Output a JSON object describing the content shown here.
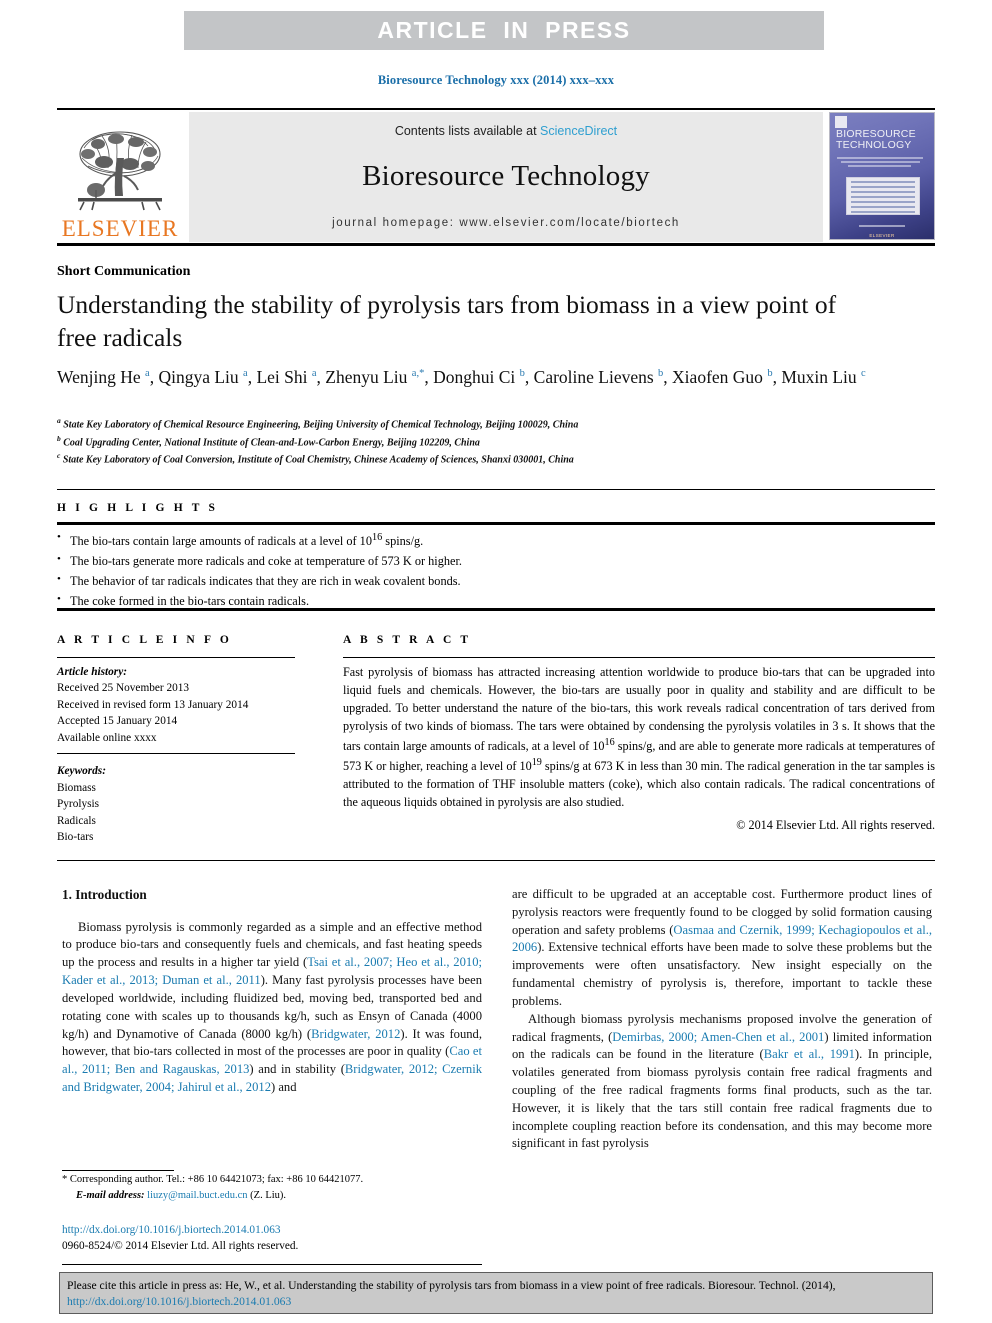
{
  "banner": {
    "text": "ARTICLE  IN  PRESS"
  },
  "running_head": "Bioresource Technology xxx (2014) xxx–xxx",
  "masthead": {
    "elsevier_wordmark": "ELSEVIER",
    "contents_prefix": "Contents lists available at ",
    "sciencedirect": "ScienceDirect",
    "journal_title": "Bioresource Technology",
    "homepage": "journal homepage: www.elsevier.com/locate/biortech",
    "cover_title_line1": "BIORESOURCE",
    "cover_title_line2": "TECHNOLOGY",
    "cover_publisher": "ELSEVIER"
  },
  "article": {
    "type": "Short Communication",
    "title": "Understanding the stability of pyrolysis tars from biomass in a view point of free radicals",
    "authors_html": "Wenjing He <sup>a</sup>, Qingya Liu <sup>a</sup>, Lei Shi <sup>a</sup>, Zhenyu Liu <sup>a,*</sup>, Donghui Ci <sup>b</sup>, Caroline Lievens <sup>b</sup>, Xiaofen Guo <sup>b</sup>, Muxin Liu <sup>c</sup>",
    "affiliations": [
      {
        "label": "a",
        "text": "State Key Laboratory of Chemical Resource Engineering, Beijing University of Chemical Technology, Beijing 100029, China"
      },
      {
        "label": "b",
        "text": "Coal Upgrading Center, National Institute of Clean-and-Low-Carbon Energy, Beijing 102209, China"
      },
      {
        "label": "c",
        "text": "State Key Laboratory of Coal Conversion, Institute of Coal Chemistry, Chinese Academy of Sciences, Shanxi 030001, China"
      }
    ]
  },
  "highlights": {
    "heading": "H I G H L I G H T S",
    "items_html": [
      "The bio-tars contain large amounts of radicals at a level of 10<sup>16</sup> spins/g.",
      "The bio-tars generate more radicals and coke at temperature of 573 K or higher.",
      "The behavior of tar radicals indicates that they are rich in weak covalent bonds.",
      "The coke formed in the bio-tars contain radicals."
    ]
  },
  "article_info": {
    "heading": "A R T I C L E    I N F O",
    "history_label": "Article history:",
    "history": [
      "Received 25 November 2013",
      "Received in revised form 13 January 2014",
      "Accepted 15 January 2014",
      "Available online xxxx"
    ],
    "keywords_label": "Keywords:",
    "keywords": [
      "Biomass",
      "Pyrolysis",
      "Radicals",
      "Bio-tars"
    ]
  },
  "abstract": {
    "heading": "A B S T R A C T",
    "body_html": "Fast pyrolysis of biomass has attracted increasing attention worldwide to produce bio-tars that can be upgraded into liquid fuels and chemicals. However, the bio-tars are usually poor in quality and stability and are difficult to be upgraded. To better understand the nature of the bio-tars, this work reveals radical concentration of tars derived from pyrolysis of two kinds of biomass. The tars were obtained by condensing the pyrolysis volatiles in 3 s. It shows that the tars contain large amounts of radicals, at a level of 10<sup>16</sup> spins/g, and are able to generate more radicals at temperatures of 573 K or higher, reaching a level of 10<sup>19</sup> spins/g at 673 K in less than 30 min. The radical generation in the tar samples is attributed to the formation of THF insoluble matters (coke), which also contain radicals. The radical concentrations of the aqueous liquids obtained in pyrolysis are also studied.",
    "rights": "© 2014 Elsevier Ltd. All rights reserved."
  },
  "body": {
    "section_heading": "1. Introduction",
    "left_paragraphs_html": [
      "Biomass pyrolysis is commonly regarded as a simple and an effective method to produce bio-tars and consequently fuels and chemicals, and fast heating speeds up the process and results in a higher tar yield (<span class=\"lnk\">Tsai et al., 2007; Heo et al., 2010; Kader et al., 2013; Duman et al., 2011</span>). Many fast pyrolysis processes have been developed worldwide, including fluidized bed, moving bed, transported bed and rotating cone with scales up to thousands kg/h, such as Ensyn of Canada (4000 kg/h) and Dynamotive of Canada (8000 kg/h) (<span class=\"lnk\">Bridgwater, 2012</span>). It was found, however, that bio-tars collected in most of the processes are poor in quality (<span class=\"lnk\">Cao et al., 2011; Ben and Ragauskas, 2013</span>) and in stability (<span class=\"lnk\">Bridgwater, 2012; Czernik and Bridgwater, 2004; Jahirul et al., 2012</span>) and"
    ],
    "right_paragraphs_html": [
      "are difficult to be upgraded at an acceptable cost. Furthermore product lines of pyrolysis reactors were frequently found to be clogged by solid formation causing operation and safety problems (<span class=\"lnk\">Oasmaa and Czernik, 1999; Kechagiopoulos et al., 2006</span>). Extensive technical efforts have been made to solve these problems but the improvements were often unsatisfactory. New insight especially on the fundamental chemistry of pyrolysis is, therefore, important to tackle these problems.",
      "Although biomass pyrolysis mechanisms proposed involve the generation of radical fragments, (<span class=\"lnk\">Demirbas, 2000; Amen-Chen et al., 2001</span>) limited information on the radicals can be found in the literature (<span class=\"lnk\">Bakr et al., 1991</span>). In principle, volatiles generated from biomass pyrolysis contain free radical fragments and coupling of the free radical fragments forms final products, such as the tar. However, it is likely that the tars still contain free radical fragments due to incomplete coupling reaction before its condensation, and this may become more significant in fast pyrolysis"
    ]
  },
  "footnote": {
    "corresponding_html": "* Corresponding author. Tel.: +86 10 64421073; fax: +86 10 64421077.",
    "email_label": "E-mail address:",
    "email": "liuzy@mail.buct.edu.cn",
    "email_suffix": "(Z. Liu)."
  },
  "doi_block": {
    "doi_url": "http://dx.doi.org/10.1016/j.biortech.2014.01.063",
    "issn_line": "0960-8524/© 2014 Elsevier Ltd. All rights reserved."
  },
  "cite_box": {
    "text_before": "Please cite this article in press as: He, W., et al. Understanding the stability of pyrolysis tars from biomass in a view point of free radicals. Bioresour. Technol. (2014), ",
    "link": "http://dx.doi.org/10.1016/j.biortech.2014.01.063"
  },
  "colors": {
    "banner_bg": "#c3c5c7",
    "link": "#1a7bb0",
    "elsevier_orange": "#e87722",
    "masthead_bg": "#e9e9e9",
    "cite_box_bg": "#c9c9c9"
  }
}
